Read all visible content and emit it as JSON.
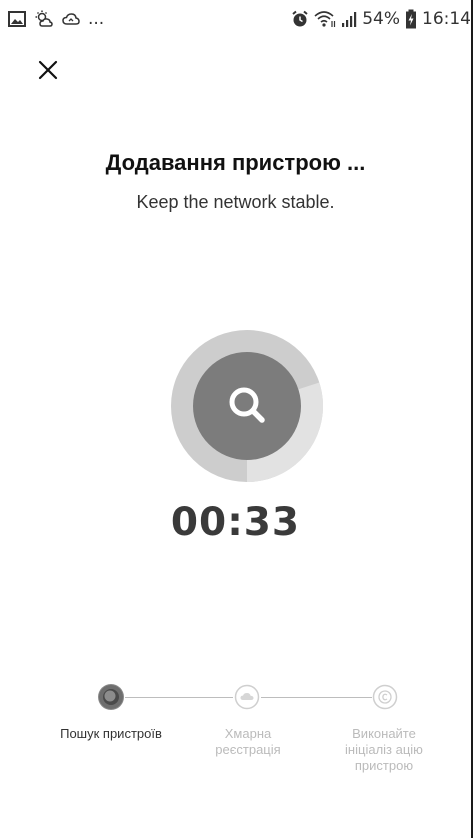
{
  "status_bar": {
    "left_overflow": "...",
    "battery_percent": "54%",
    "time": "16:14"
  },
  "header": {
    "close_icon": "close-icon"
  },
  "main": {
    "title": "Додавання пристрою ...",
    "subtitle": "Keep the network stable.",
    "timer": "00:33",
    "progress_fraction": 0.3
  },
  "steps": [
    {
      "label": "Пошук пристроїв",
      "state": "active",
      "icon": "search-step-icon"
    },
    {
      "label": "Хмарна реєстрація",
      "state": "pending",
      "icon": "cloud-icon"
    },
    {
      "label": "Виконайте ініціаліз ацію пристрою",
      "state": "pending",
      "icon": "copyright-icon"
    }
  ],
  "colors": {
    "ring_outer": "#c8c8c8",
    "ring_progress": "#bcbcbc",
    "inner_circle": "#7a7a7a",
    "text_dark": "#111111",
    "inactive": "#bbbbbb"
  }
}
